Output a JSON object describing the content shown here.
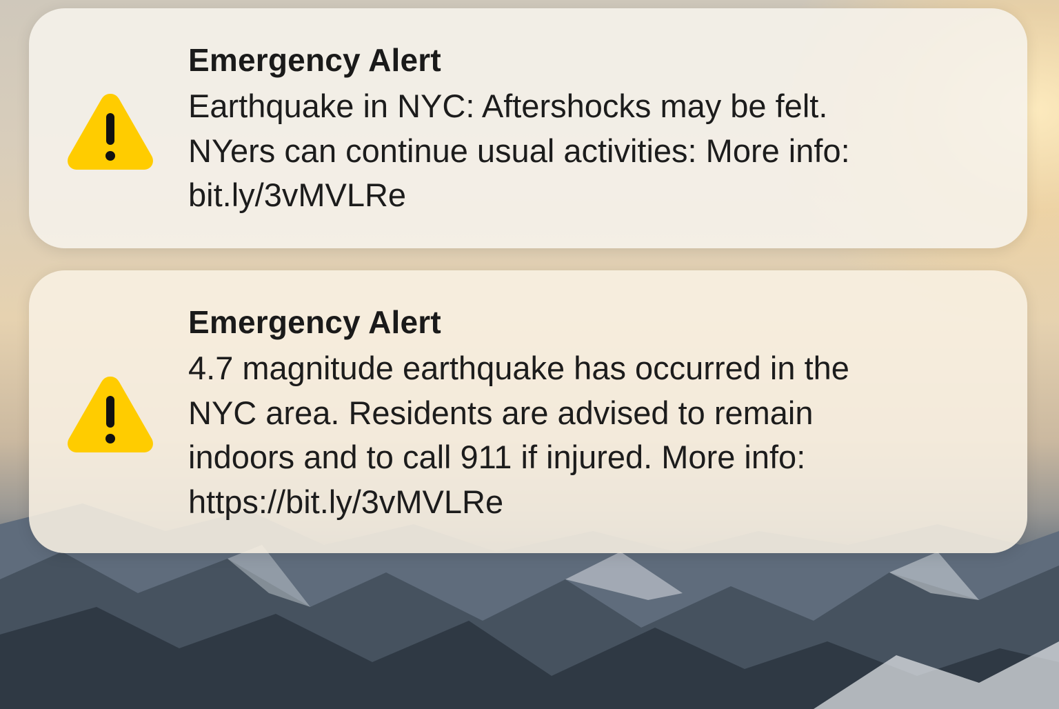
{
  "notifications": [
    {
      "title": "Emergency Alert",
      "icon": "warning-triangle-icon",
      "message": "Earthquake in NYC: Aftershocks may be felt.\nNYers can continue usual activities: More info:\nbit.ly/3vMVLRe"
    },
    {
      "title": "Emergency Alert",
      "icon": "warning-triangle-icon",
      "message": "4.7 magnitude earthquake has occurred in the\nNYC area. Residents are advised to remain\nindoors and to call 911 if injured. More info:\nhttps://bit.ly/3vMVLRe"
    }
  ],
  "colors": {
    "warning_yellow": "#FFCC00",
    "text": "#1C1C1C"
  }
}
